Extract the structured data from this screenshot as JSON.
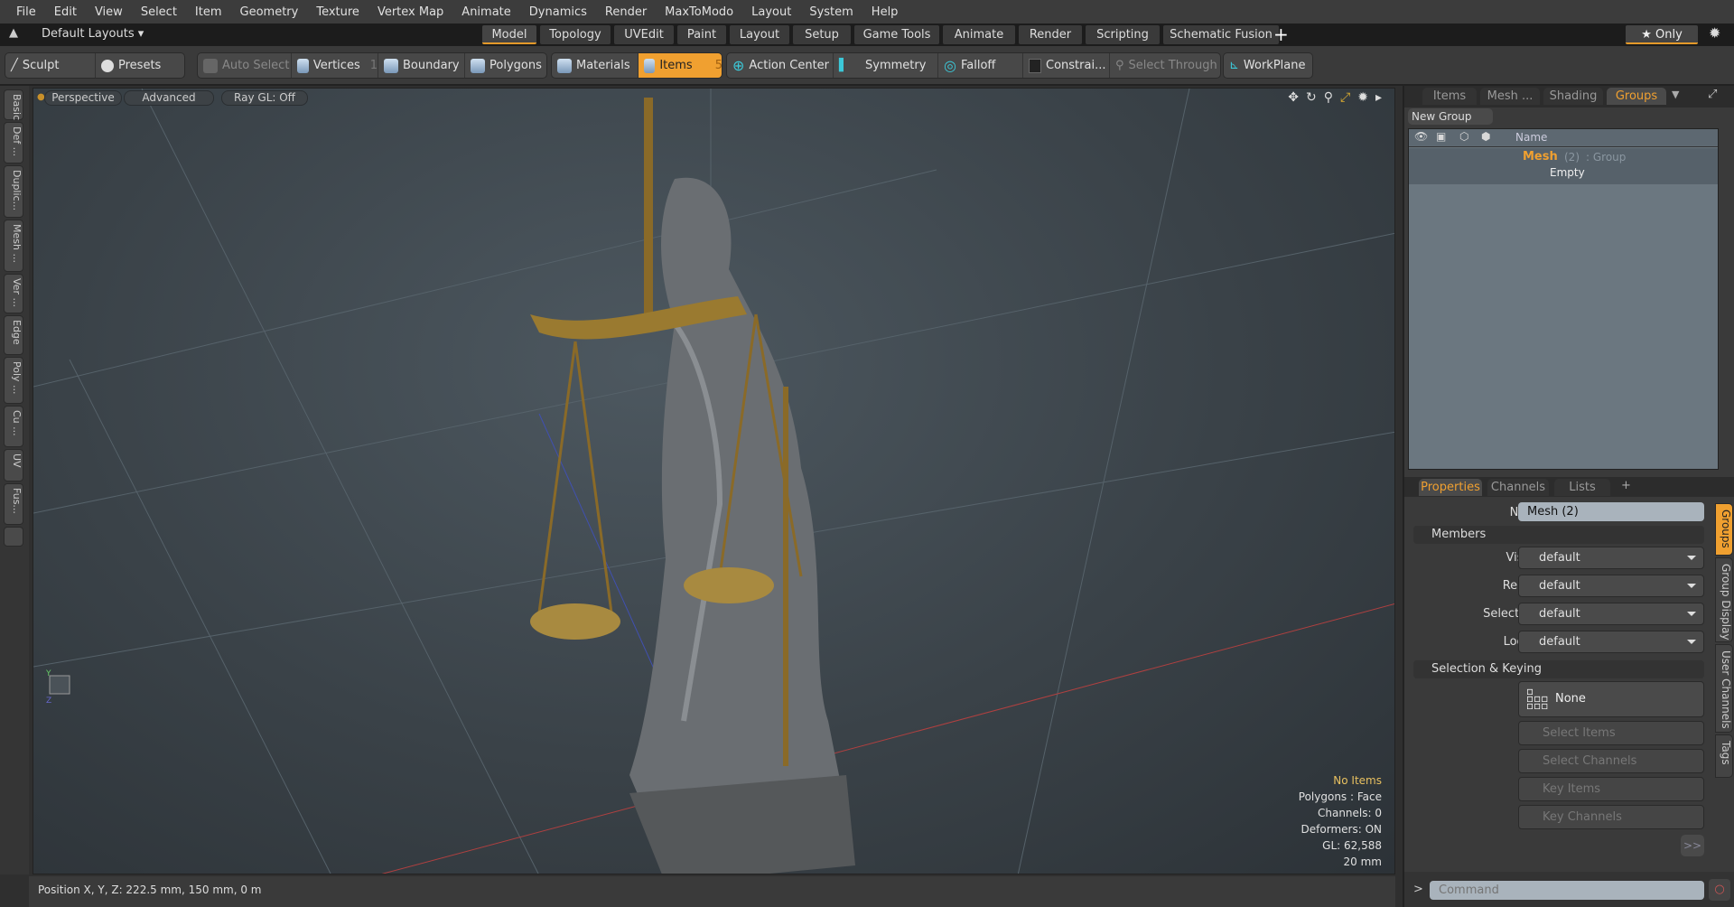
{
  "menu": [
    "File",
    "Edit",
    "View",
    "Select",
    "Item",
    "Geometry",
    "Texture",
    "Vertex Map",
    "Animate",
    "Dynamics",
    "Render",
    "MaxToModo",
    "Layout",
    "System",
    "Help"
  ],
  "layouts": {
    "label": "Default Layouts ▾",
    "tabs": [
      "Model",
      "Topology",
      "UVEdit",
      "Paint",
      "Layout",
      "Setup",
      "Game Tools",
      "Animate",
      "Render",
      "Scripting",
      "Schematic Fusion"
    ],
    "active": "Model",
    "add": "+",
    "only": "★ Only"
  },
  "toolbar": {
    "sculpt": "Sculpt",
    "presets": "Presets",
    "auto_select": "Auto Select",
    "vertices": "Vertices",
    "vertices_count": "1",
    "boundary": "Boundary",
    "polygons": "Polygons",
    "materials": "Materials",
    "items": "Items",
    "items_count": "5",
    "action_center": "Action Center",
    "symmetry": "Symmetry",
    "falloff": "Falloff",
    "constraints": "Constrai...",
    "select_through": "Select Through",
    "workplane": "WorkPlane"
  },
  "left_tabs": [
    "Basic",
    "Def ...",
    "Duplic...",
    "Mesh ...",
    "Ver ...",
    "Edge",
    "Poly ...",
    "Cu ...",
    "UV",
    "Fus..."
  ],
  "viewport": {
    "perspective": "Perspective",
    "advanced": "Advanced",
    "raygl": "Ray GL: Off",
    "info": {
      "items": "No Items",
      "polygons": "Polygons : Face",
      "channels": "Channels: 0",
      "deformers": "Deformers: ON",
      "gl": "GL: 62,588",
      "scale": "20 mm"
    }
  },
  "status": "Position X, Y, Z:   222.5 mm, 150 mm, 0 m",
  "right_top": {
    "tabs": [
      "Items",
      "Mesh ...",
      "Shading",
      "Groups"
    ],
    "active": "Groups",
    "new_group": "New Group",
    "col_name": "Name",
    "group": {
      "name": "Mesh",
      "count": "(2)",
      "type": ": Group",
      "sub": "Empty"
    }
  },
  "properties": {
    "tabs": [
      "Properties",
      "Channels",
      "Lists"
    ],
    "active": "Properties",
    "add": "+",
    "name_label": "Name",
    "name_value": "Mesh (2)",
    "members": "Members",
    "fields": [
      {
        "label": "Visible",
        "value": "default"
      },
      {
        "label": "Render",
        "value": "default"
      },
      {
        "label": "Selectable",
        "value": "default"
      },
      {
        "label": "Locked",
        "value": "default"
      }
    ],
    "sel_keying": "Selection & Keying",
    "none": "None",
    "select_items": "Select Items",
    "select_channels": "Select Channels",
    "key_items": "Key Items",
    "key_channels": "Key Channels",
    "more": ">>",
    "side_tabs": [
      "Groups",
      "Group Display",
      "User Channels",
      "Tags"
    ]
  },
  "command": {
    "placeholder": "Command",
    "prompt": ">"
  },
  "colors": {
    "accent": "#f0a030",
    "gold": "#9a7a30"
  }
}
